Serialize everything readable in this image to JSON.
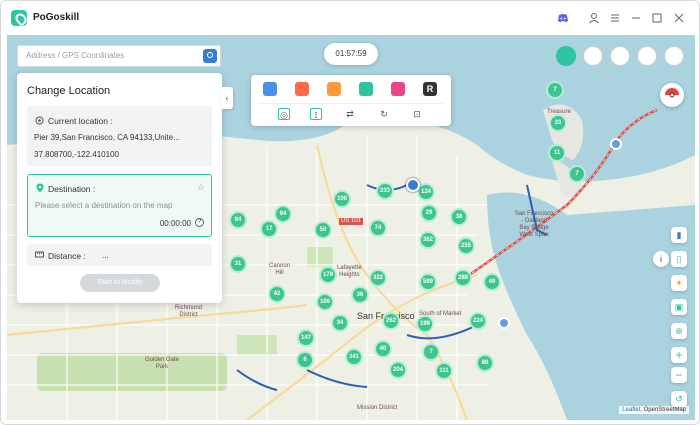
{
  "app": {
    "title": "PoGoskill"
  },
  "search": {
    "placeholder": "Address / GPS Coordinates"
  },
  "timer": "01:57:59",
  "panel": {
    "title": "Change Location",
    "current": {
      "label": "Current location :",
      "address": "Pier 39,San Francisco, CA  94133,Unite...",
      "coords": "37.808700,-122.410100"
    },
    "destination": {
      "label": "Destination :",
      "placeholder": "Please select a destination on the map",
      "time": "00:00:00"
    },
    "distance": {
      "label": "Distance :",
      "value": "..."
    },
    "modify_button": "Start to Modify"
  },
  "map": {
    "places": [
      {
        "text": "Treasure\nIs"
      },
      {
        "text": "San Francisco\n- Oakland\nBay Bridge\nWest Span"
      },
      {
        "text": "Cannon\nHill"
      },
      {
        "text": "Lafayette\nHeights"
      },
      {
        "text": "Richmond\nDistrict"
      },
      {
        "text": "Golden Gate\nPark"
      },
      {
        "text": "San Francisco"
      },
      {
        "text": "South of Market"
      },
      {
        "text": "Mission District"
      },
      {
        "text": "US 101"
      }
    ],
    "clusters": [
      "7",
      "33",
      "11",
      "7",
      "106",
      "233",
      "124",
      "94",
      "17",
      "94",
      "50",
      "29",
      "38",
      "74",
      "362",
      "255",
      "179",
      "322",
      "599",
      "288",
      "49",
      "42",
      "106",
      "36",
      "34",
      "262",
      "199",
      "224",
      "147",
      "6",
      "341",
      "40",
      "7",
      "111",
      "88",
      "204",
      "31"
    ],
    "attribution_leaf": "Leaflet",
    "attribution": ", OpenStreetMap"
  },
  "icons": [
    "discord-icon",
    "user-icon",
    "menu-icon",
    "minimize-icon",
    "maximize-icon",
    "close-icon"
  ],
  "colors": {
    "accent": "#2ec4a0",
    "cluster": "#3cc58e",
    "route": "#d9534f"
  }
}
